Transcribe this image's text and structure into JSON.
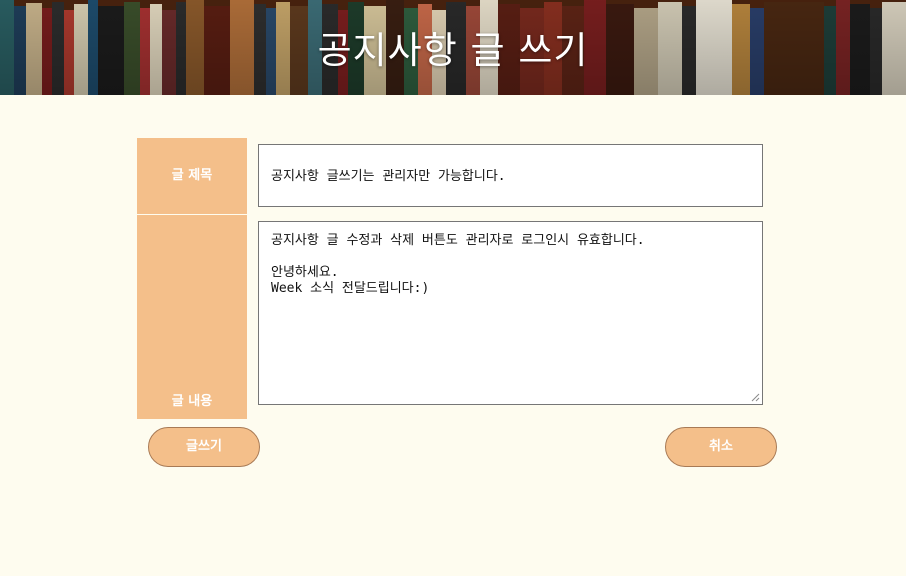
{
  "header": {
    "title": "공지사항 글 쓰기"
  },
  "form": {
    "title_label": "글 제목",
    "title_value": "공지사항 글쓰기는 관리자만 가능합니다.",
    "content_label": "글 내용",
    "content_value": "공지사항 글 수정과 삭제 버튼도 관리자로 로그인시 유효합니다.\n\n안녕하세요.\nWeek 소식 전달드립니다:)"
  },
  "buttons": {
    "submit_label": "글쓰기",
    "cancel_label": "취소"
  },
  "colors": {
    "page_background": "#fefcef",
    "accent": "#f4bf8a"
  }
}
